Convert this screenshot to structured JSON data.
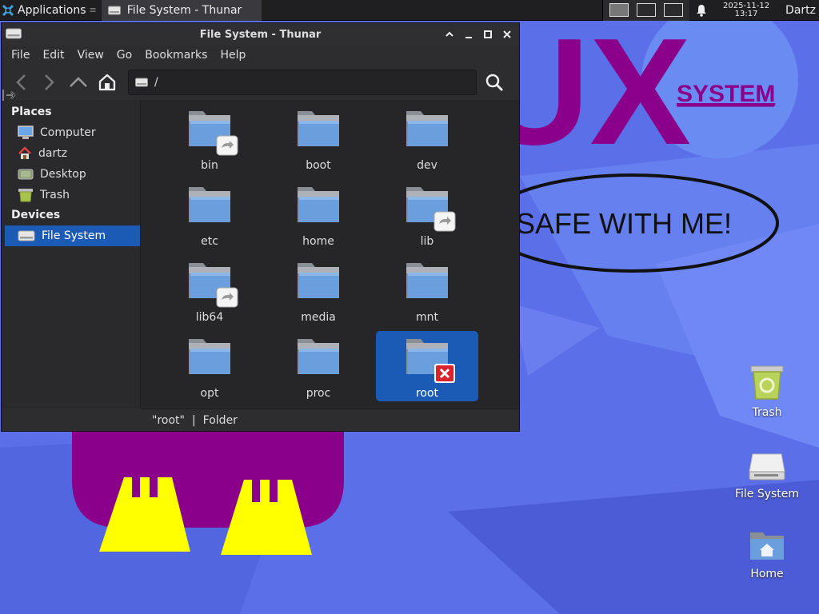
{
  "panel": {
    "applications_label": "Applications",
    "task_label": "File System - Thunar",
    "clock_date": "2025-11-12",
    "clock_time": "13:17",
    "user": "Dartz"
  },
  "wallpaper": {
    "big_text": "UX",
    "system_text": "SYSTEM",
    "safe_text": "SAFE WITH ME!"
  },
  "window": {
    "title": "File System - Thunar",
    "menu": [
      "File",
      "Edit",
      "View",
      "Go",
      "Bookmarks",
      "Help"
    ],
    "path": "/",
    "sidebar": {
      "places_header": "Places",
      "places": [
        {
          "label": "Computer",
          "icon": "computer-icon"
        },
        {
          "label": "dartz",
          "icon": "home-icon"
        },
        {
          "label": "Desktop",
          "icon": "desktop-icon"
        },
        {
          "label": "Trash",
          "icon": "trash-icon"
        }
      ],
      "devices_header": "Devices",
      "devices": [
        {
          "label": "File System",
          "icon": "drive-icon",
          "selected": true
        }
      ]
    },
    "files": [
      {
        "name": "bin",
        "emblem": "symlink"
      },
      {
        "name": "boot",
        "emblem": ""
      },
      {
        "name": "dev",
        "emblem": ""
      },
      {
        "name": "etc",
        "emblem": ""
      },
      {
        "name": "home",
        "emblem": ""
      },
      {
        "name": "lib",
        "emblem": "symlink"
      },
      {
        "name": "lib64",
        "emblem": "symlink"
      },
      {
        "name": "media",
        "emblem": ""
      },
      {
        "name": "mnt",
        "emblem": ""
      },
      {
        "name": "opt",
        "emblem": ""
      },
      {
        "name": "proc",
        "emblem": ""
      },
      {
        "name": "root",
        "emblem": "unreadable",
        "selected": true
      }
    ],
    "status": {
      "name": "\"root\"",
      "separator": "|",
      "kind": "Folder"
    }
  },
  "desktop_icons": [
    {
      "label": "Trash",
      "icon": "trash-icon"
    },
    {
      "label": "File System",
      "icon": "drive-icon"
    },
    {
      "label": "Home",
      "icon": "home-folder-icon"
    }
  ],
  "colors": {
    "accent": "#1c5bb5",
    "wallpaper": "#5b6fe8",
    "purple": "#8b008b",
    "yellow": "#ffff00"
  }
}
